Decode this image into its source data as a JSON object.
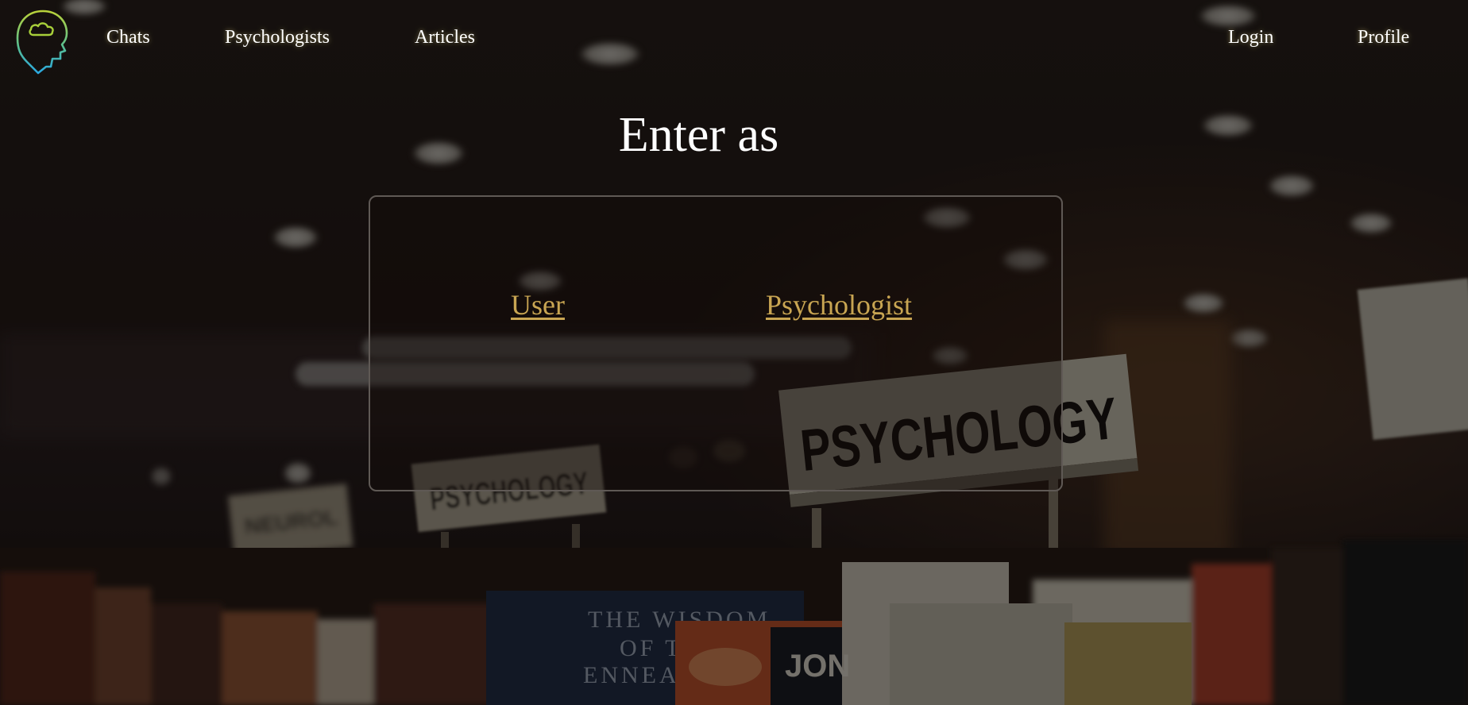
{
  "nav": {
    "logo_icon": "head-with-cloud-icon",
    "links": {
      "chats": "Chats",
      "psychologists": "Psychologists",
      "articles": "Articles",
      "login": "Login",
      "profile": "Profile"
    }
  },
  "main": {
    "title": "Enter as",
    "options": {
      "user": "User",
      "psychologist": "Psychologist"
    }
  },
  "background": {
    "scene": "bookstore-psychology-shelves",
    "signs": [
      "PSYCHOLOGY",
      "PSYCHOLOGY"
    ],
    "book_spine": "THE WISDOM OF THE ENNEAGRAM"
  },
  "colors": {
    "link_gold": "#c8a552",
    "nav_text": "#ffffff",
    "panel_border": "#5f5955",
    "background_dark": "#1d1512",
    "logo_green": "#a8cf3a",
    "logo_blue": "#2aa8e0"
  }
}
